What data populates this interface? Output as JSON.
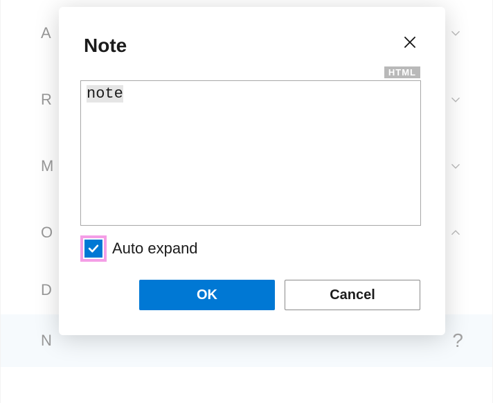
{
  "dialog": {
    "title": "Note",
    "html_badge": "HTML",
    "note_value": "note",
    "checkbox_label": "Auto expand",
    "ok_label": "OK",
    "cancel_label": "Cancel"
  },
  "bg": {
    "items": [
      "A",
      "R",
      "M",
      "O",
      "D",
      "N"
    ],
    "help": "?"
  }
}
